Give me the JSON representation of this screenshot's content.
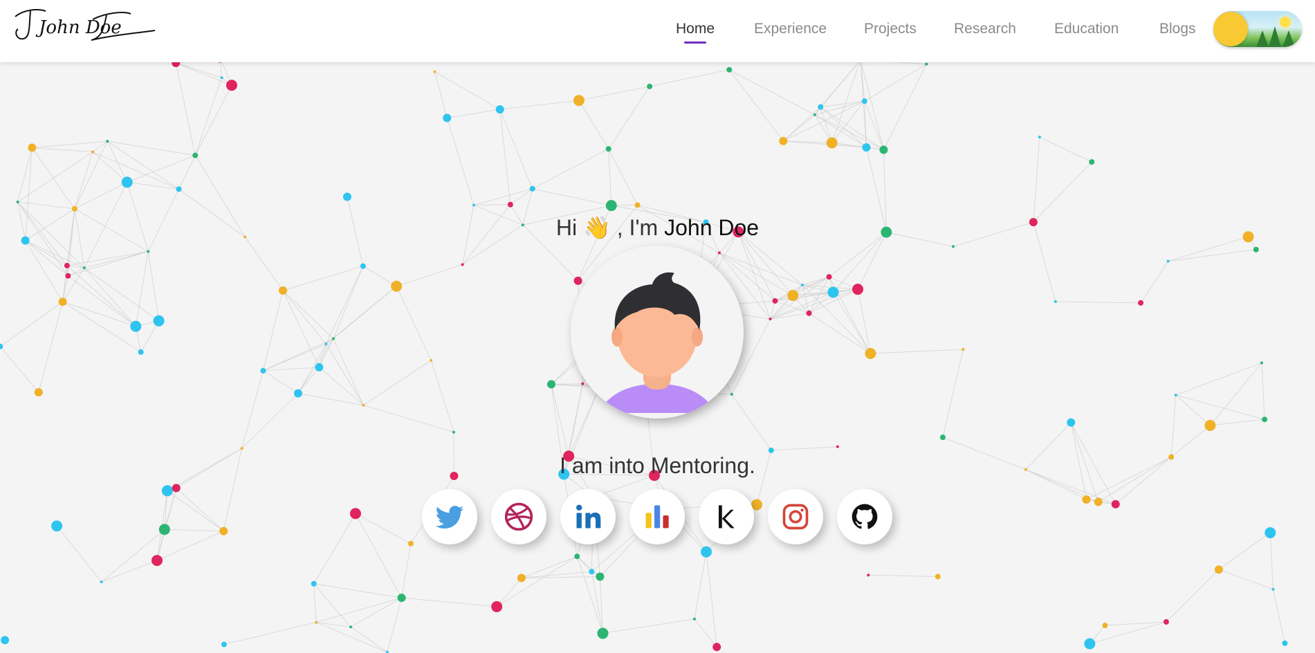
{
  "header": {
    "logo_text": "John Doe",
    "nav": [
      {
        "label": "Home",
        "active": true
      },
      {
        "label": "Experience",
        "active": false
      },
      {
        "label": "Projects",
        "active": false
      },
      {
        "label": "Research",
        "active": false
      },
      {
        "label": "Education",
        "active": false
      },
      {
        "label": "Blogs",
        "active": false
      }
    ],
    "theme_toggle": {
      "mode": "light"
    }
  },
  "hero": {
    "greeting_prefix": "Hi",
    "wave_emoji": "👋",
    "greeting_mid": ", I'm",
    "name": "John Doe",
    "tagline_prefix": "I am into",
    "tagline_word": "Mentoring."
  },
  "socials": [
    {
      "name": "twitter",
      "icon": "twitter-icon",
      "color": "#4a9fe0"
    },
    {
      "name": "dribbble",
      "icon": "dribbble-icon",
      "color": "#b3245b"
    },
    {
      "name": "linkedin",
      "icon": "linkedin-icon",
      "color": "#1b6fb5"
    },
    {
      "name": "analytics",
      "icon": "bar-chart-icon",
      "color": "#f2c418"
    },
    {
      "name": "kaggle",
      "icon": "kaggle-icon",
      "color": "#111111"
    },
    {
      "name": "instagram",
      "icon": "instagram-icon",
      "color": "#d4453b"
    },
    {
      "name": "github",
      "icon": "github-icon",
      "color": "#111111"
    }
  ],
  "colors": {
    "accent": "#6f2dbd",
    "node_blue": "#2ec4f0",
    "node_green": "#2cb572",
    "node_orange": "#f0b127",
    "node_red": "#e0245e"
  }
}
